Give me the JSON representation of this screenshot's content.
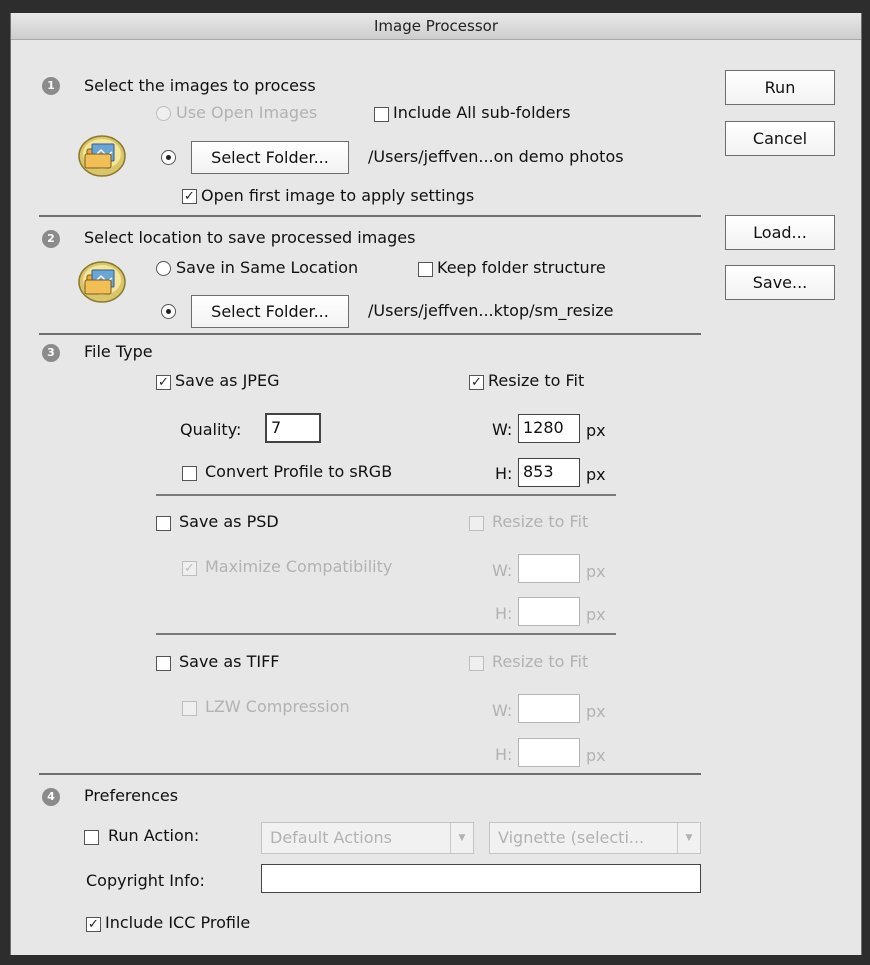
{
  "window": {
    "title": "Image Processor"
  },
  "buttons": {
    "run": "Run",
    "cancel": "Cancel",
    "load": "Load...",
    "save": "Save..."
  },
  "section1": {
    "number": "1",
    "title": "Select the images to process",
    "use_open_images": "Use Open Images",
    "include_subfolders": "Include All sub-folders",
    "select_folder": "Select Folder...",
    "folder_path": "/Users/jeffven...on demo photos",
    "open_first": "Open first image to apply settings"
  },
  "section2": {
    "number": "2",
    "title": "Select location to save processed images",
    "same_location": "Save in Same Location",
    "keep_structure": "Keep folder structure",
    "select_folder": "Select Folder...",
    "folder_path": "/Users/jeffven...ktop/sm_resize"
  },
  "section3": {
    "number": "3",
    "title": "File Type",
    "jpeg": {
      "save_label": "Save as JPEG",
      "quality_label": "Quality:",
      "quality_value": "7",
      "convert_profile": "Convert Profile to sRGB",
      "resize_label": "Resize to Fit",
      "w_label": "W:",
      "w_value": "1280",
      "h_label": "H:",
      "h_value": "853",
      "unit": "px"
    },
    "psd": {
      "save_label": "Save as PSD",
      "maximize": "Maximize Compatibility",
      "resize_label": "Resize to Fit",
      "w_label": "W:",
      "h_label": "H:",
      "unit": "px"
    },
    "tiff": {
      "save_label": "Save as TIFF",
      "lzw": "LZW Compression",
      "resize_label": "Resize to Fit",
      "w_label": "W:",
      "h_label": "H:",
      "unit": "px"
    }
  },
  "section4": {
    "number": "4",
    "title": "Preferences",
    "run_action": "Run Action:",
    "action_set": "Default Actions",
    "action": "Vignette (selecti...",
    "copyright_label": "Copyright Info:",
    "copyright_value": "",
    "include_icc": "Include ICC Profile"
  },
  "icons": {
    "folder": "folder-icon",
    "check": "checkmark-icon",
    "dropdown": "chevron-down-icon"
  }
}
